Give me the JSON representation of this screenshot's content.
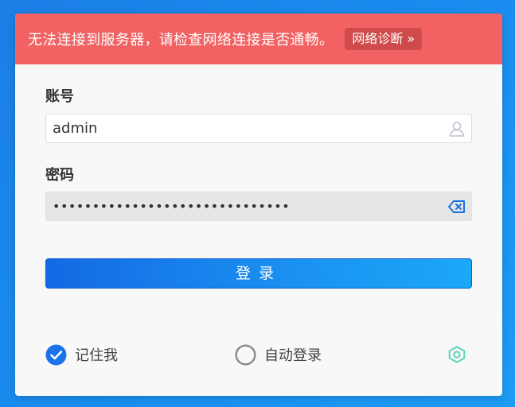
{
  "banner": {
    "message": "无法连接到服务器，请检查网络连接是否通畅。",
    "diagnose_button": "网络诊断 »",
    "color": "#f26262"
  },
  "form": {
    "account_label": "账号",
    "account_value": "admin",
    "account_icon": "user-icon",
    "password_label": "密码",
    "password_value": "••••••••••••••••••••••••••••••",
    "password_icon": "backspace-clear-icon",
    "login_button": "登录"
  },
  "options": {
    "remember_me": {
      "label": "记住我",
      "checked": true
    },
    "auto_login": {
      "label": "自动登录",
      "checked": false
    },
    "settings_icon": "gear-icon"
  },
  "colors": {
    "accent": "#1a73e8",
    "settings_icon": "#5ad6b8"
  }
}
